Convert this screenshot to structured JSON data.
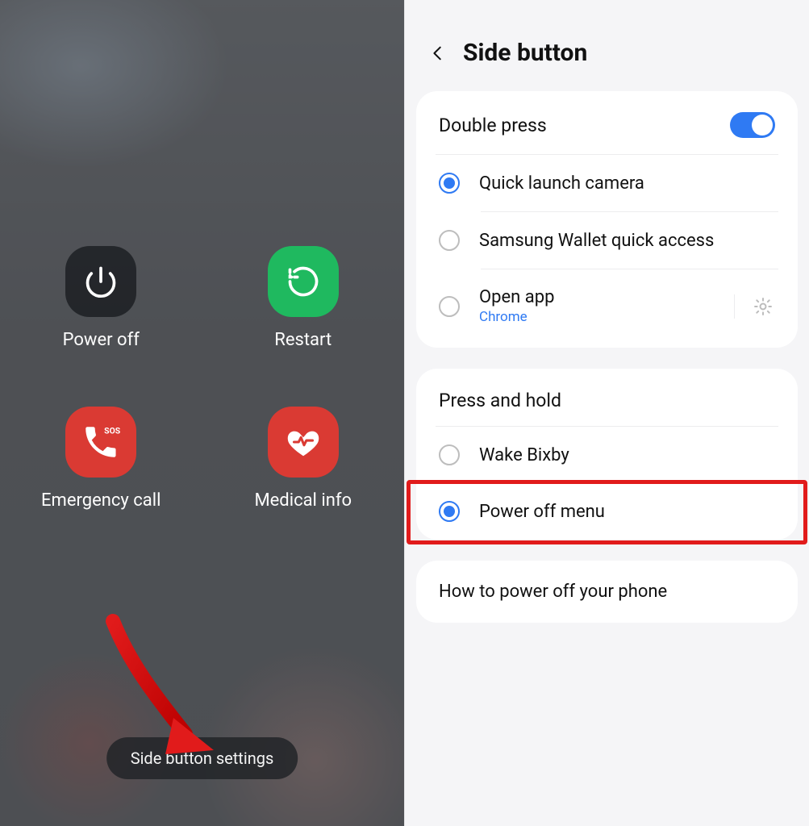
{
  "left": {
    "power_menu": {
      "items": [
        {
          "id": "power-off",
          "label": "Power off"
        },
        {
          "id": "restart",
          "label": "Restart"
        },
        {
          "id": "emergency-call",
          "label": "Emergency call"
        },
        {
          "id": "medical-info",
          "label": "Medical info"
        }
      ]
    },
    "side_button_settings_label": "Side button settings"
  },
  "right": {
    "title": "Side button",
    "sections": {
      "double_press": {
        "header": "Double press",
        "toggle_on": true,
        "options": [
          {
            "id": "camera",
            "label": "Quick launch camera",
            "selected": true
          },
          {
            "id": "wallet",
            "label": "Samsung Wallet quick access",
            "selected": false
          },
          {
            "id": "openapp",
            "label": "Open app",
            "sub": "Chrome",
            "selected": false,
            "gear": true
          }
        ]
      },
      "press_hold": {
        "header": "Press and hold",
        "options": [
          {
            "id": "bixby",
            "label": "Wake Bixby",
            "selected": false
          },
          {
            "id": "poweroff",
            "label": "Power off menu",
            "selected": true,
            "highlighted": true
          }
        ]
      }
    },
    "info_link": "How to power off your phone"
  },
  "annotation": {
    "arrow_target": "side-button-settings-pill",
    "highlight_target": "press-hold-poweroff-row"
  },
  "colors": {
    "accent_blue": "#2f7af3",
    "danger_red": "#da3a33",
    "success_green": "#1fb95f"
  }
}
